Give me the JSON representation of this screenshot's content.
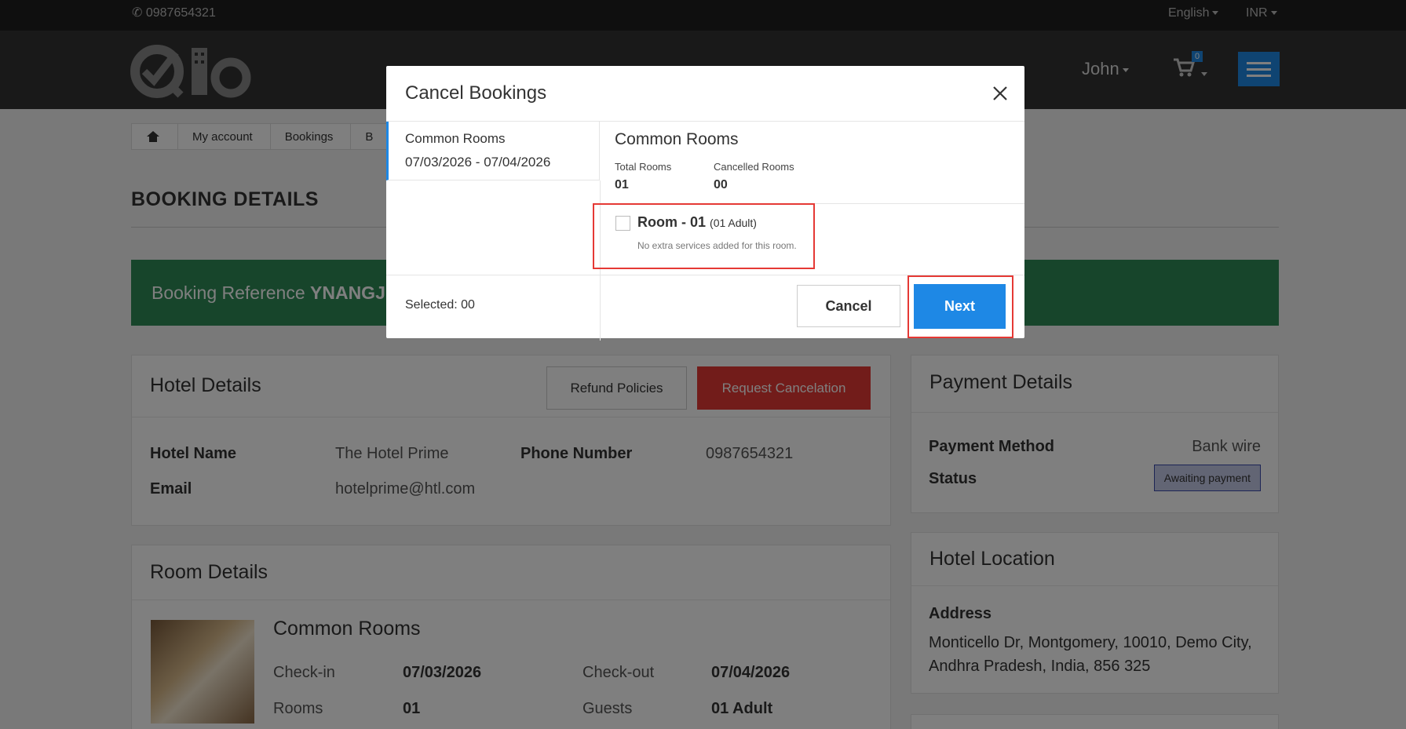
{
  "topbar": {
    "phone": "0987654321",
    "language": "English",
    "currency": "INR"
  },
  "header": {
    "logo_text": "Qlo",
    "user_name": "John",
    "cart_count": "0"
  },
  "breadcrumb": {
    "items": [
      "My account",
      "Bookings",
      "B"
    ]
  },
  "page": {
    "title": "BOOKING DETAILS",
    "booking_ref_label": "Booking Reference",
    "booking_ref_value": "YNANGJK"
  },
  "hotel_details": {
    "title": "Hotel Details",
    "refund_policies_label": "Refund Policies",
    "request_cancel_label": "Request Cancelation",
    "hotel_name_label": "Hotel Name",
    "hotel_name": "The Hotel Prime",
    "phone_label": "Phone Number",
    "phone": "0987654321",
    "email_label": "Email",
    "email": "hotelprime@htl.com"
  },
  "room_details": {
    "title": "Room Details",
    "room_type": "Common Rooms",
    "checkin_label": "Check-in",
    "checkin": "07/03/2026",
    "checkout_label": "Check-out",
    "checkout": "07/04/2026",
    "rooms_label": "Rooms",
    "rooms": "01",
    "guests_label": "Guests",
    "guests": "01 Adult"
  },
  "payment_details": {
    "title": "Payment Details",
    "method_label": "Payment Method",
    "method": "Bank wire",
    "status_label": "Status",
    "status": "Awaiting payment"
  },
  "hotel_location": {
    "title": "Hotel Location",
    "address_label": "Address",
    "address_line1": "Monticello Dr, Montgomery, 10010, Demo City,",
    "address_line2": "Andhra Pradesh, India, 856 325"
  },
  "modal": {
    "title": "Cancel Bookings",
    "tab_room_type": "Common Rooms",
    "tab_dates": "07/03/2026 - 07/04/2026",
    "room_type_title": "Common Rooms",
    "total_rooms_label": "Total Rooms",
    "total_rooms": "01",
    "cancelled_rooms_label": "Cancelled Rooms",
    "cancelled_rooms": "00",
    "room_label": "Room - 01",
    "room_guests": "(01 Adult)",
    "room_note": "No extra services added for this room.",
    "selected_text": "Selected: 00",
    "cancel_label": "Cancel",
    "next_label": "Next"
  }
}
